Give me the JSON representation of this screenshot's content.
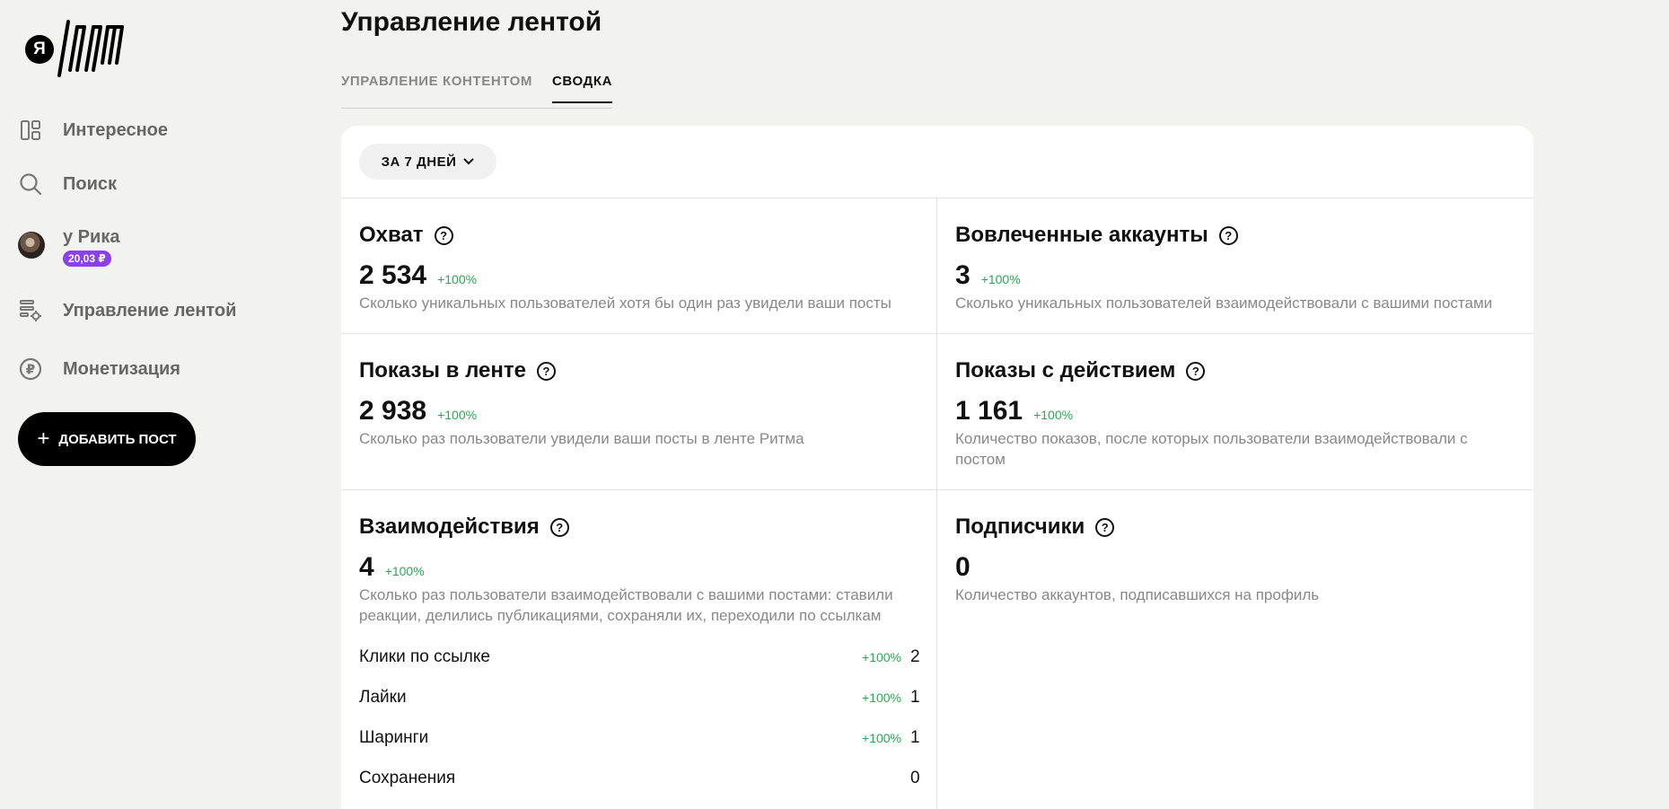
{
  "logo": {
    "letter": "Я"
  },
  "sidebar": {
    "items": [
      {
        "label": "Интересное",
        "icon": "feed-icon"
      },
      {
        "label": "Поиск",
        "icon": "search-icon"
      },
      {
        "label": "Управление лентой",
        "icon": "feed-settings-icon"
      },
      {
        "label": "Монетизация",
        "icon": "ruble-icon"
      }
    ],
    "profile": {
      "name": "у Рика",
      "balance": "20,03 ₽"
    },
    "add_post_label": "ДОБАВИТЬ ПОСТ"
  },
  "page": {
    "title": "Управление лентой",
    "tabs": [
      {
        "label": "УПРАВЛЕНИЕ КОНТЕНТОМ",
        "active": false
      },
      {
        "label": "СВОДКА",
        "active": true
      }
    ],
    "period_label": "ЗА 7 ДНЕЙ"
  },
  "metrics": [
    {
      "title": "Охват",
      "value": "2 534",
      "delta": "+100%",
      "desc": "Сколько уникальных пользователей хотя бы один раз увидели ваши посты"
    },
    {
      "title": "Вовлеченные аккаунты",
      "value": "3",
      "delta": "+100%",
      "desc": "Сколько уникальных пользователей взаимодействовали с вашими постами"
    },
    {
      "title": "Показы в ленте",
      "value": "2 938",
      "delta": "+100%",
      "desc": "Сколько раз пользователи увидели ваши посты в ленте Ритма"
    },
    {
      "title": "Показы с действием",
      "value": "1 161",
      "delta": "+100%",
      "desc": "Количество показов, после которых пользователи взаимодействовали с постом"
    },
    {
      "title": "Взаимодействия",
      "value": "4",
      "delta": "+100%",
      "desc": "Сколько раз пользователи взаимодействовали с вашими постами: ставили реакции, делились публикациями, сохраняли их, переходили по ссылкам"
    },
    {
      "title": "Подписчики",
      "value": "0",
      "delta": "",
      "desc": "Количество аккаунтов, подписавшихся на профиль"
    }
  ],
  "interactions_breakdown": [
    {
      "label": "Клики по ссылке",
      "delta": "+100%",
      "value": "2"
    },
    {
      "label": "Лайки",
      "delta": "+100%",
      "value": "1"
    },
    {
      "label": "Шаринги",
      "delta": "+100%",
      "value": "1"
    },
    {
      "label": "Сохранения",
      "delta": "",
      "value": "0"
    }
  ],
  "colors": {
    "accent_green": "#2aa852",
    "badge_purple": "#8a3ff0",
    "background": "#f2f2f0"
  }
}
